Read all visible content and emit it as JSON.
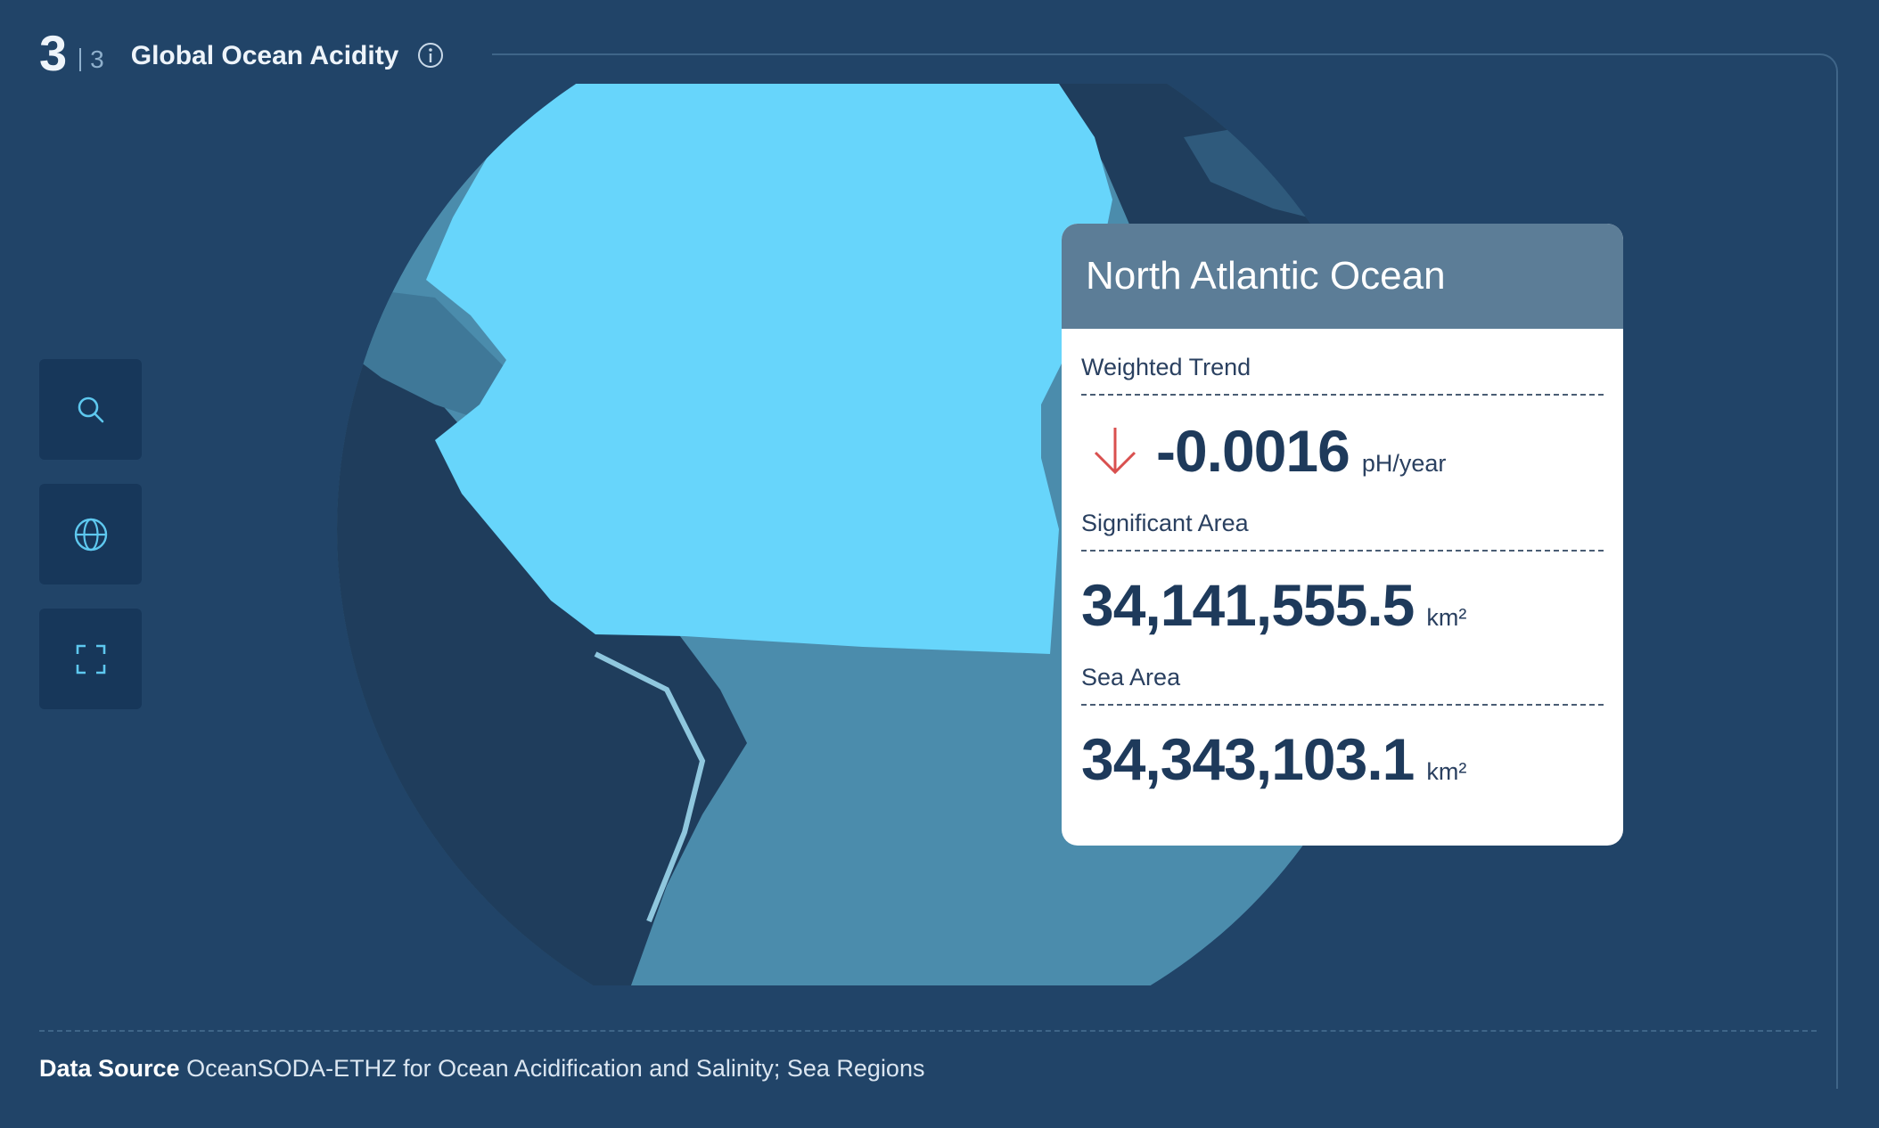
{
  "header": {
    "step_current": "3",
    "step_total": "3",
    "title": "Global Ocean Acidity"
  },
  "icons": {
    "info": "info-icon",
    "search": "search-icon",
    "globe": "globe-icon",
    "fullscreen": "fullscreen-icon",
    "trend": "arrow-down-icon"
  },
  "tooltip": {
    "title": "North Atlantic Ocean",
    "metrics": [
      {
        "label": "Weighted Trend",
        "value": "-0.0016",
        "unit": "pH/year"
      },
      {
        "label": "Significant Area",
        "value": "34,141,555.5",
        "unit": "km²"
      },
      {
        "label": "Sea Area",
        "value": "34,343,103.1",
        "unit": "km²"
      }
    ]
  },
  "footer": {
    "source_label": "Data Source",
    "source_text": "OceanSODA-ETHZ for Ocean Acidification and Salinity; Sea Regions"
  },
  "colors": {
    "background": "#214468",
    "highlight_region": "#67d5fb",
    "ocean": "#4b8cac",
    "land": "#1f3d5c",
    "trend_arrow": "#d9504f",
    "tooltip_header": "#5c7d97"
  }
}
